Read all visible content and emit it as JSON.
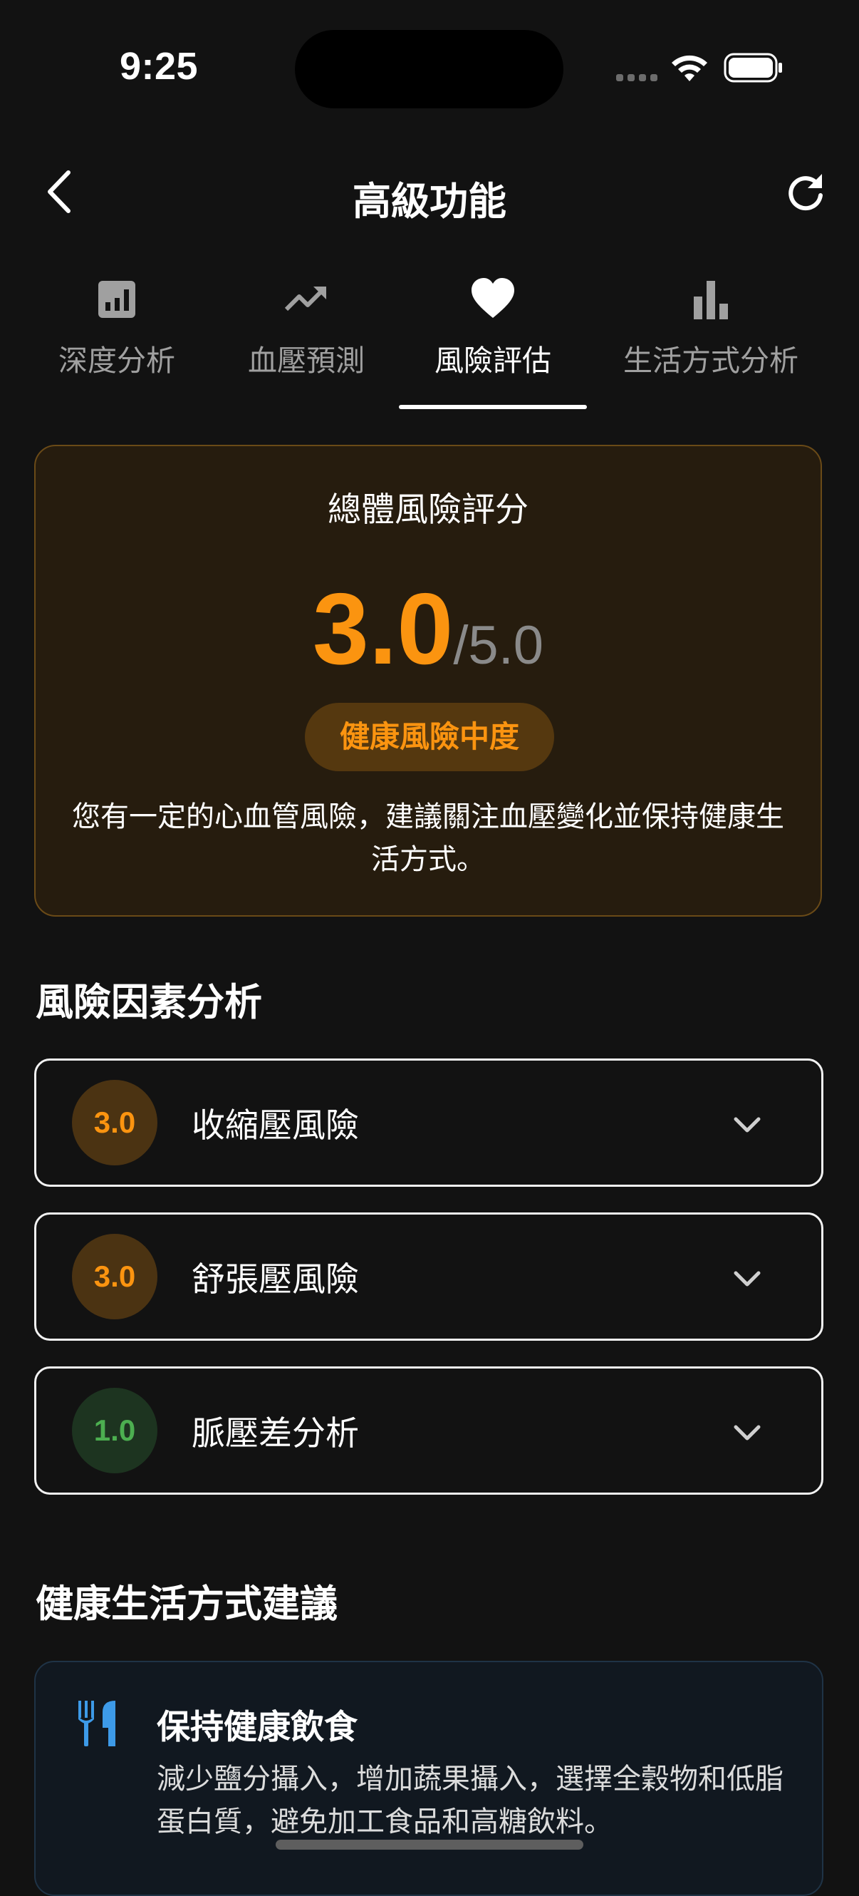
{
  "status_bar": {
    "time": "9:25"
  },
  "header": {
    "title": "高級功能",
    "back_icon": "chevron-left-icon",
    "refresh_icon": "refresh-icon"
  },
  "tabs": [
    {
      "label": "深度分析",
      "icon": "analytics-icon",
      "active": false
    },
    {
      "label": "血壓預測",
      "icon": "trending-up-icon",
      "active": false
    },
    {
      "label": "風險評估",
      "icon": "heart-icon",
      "active": true
    },
    {
      "label": "生活方式分析",
      "icon": "bar-chart-icon",
      "active": false
    }
  ],
  "overall_risk": {
    "title": "總體風險評分",
    "score": "3.0",
    "max": "/5.0",
    "badge": "健康風險中度",
    "description": "您有一定的心血管風險，建議關注血壓變化並保持健康生活方式。",
    "accent_color": "#fb9410"
  },
  "risk_factors": {
    "title": "風險因素分析",
    "items": [
      {
        "score": "3.0",
        "label": "收縮壓風險",
        "level": "orange"
      },
      {
        "score": "3.0",
        "label": "舒張壓風險",
        "level": "orange"
      },
      {
        "score": "1.0",
        "label": "脈壓差分析",
        "level": "green"
      }
    ]
  },
  "lifestyle": {
    "title": "健康生活方式建議",
    "cards": [
      {
        "icon": "utensils-icon",
        "title": "保持健康飲食",
        "description": "減少鹽分攝入，增加蔬果攝入，選擇全穀物和低脂蛋白質，避免加工食品和高糖飲料。"
      }
    ]
  }
}
